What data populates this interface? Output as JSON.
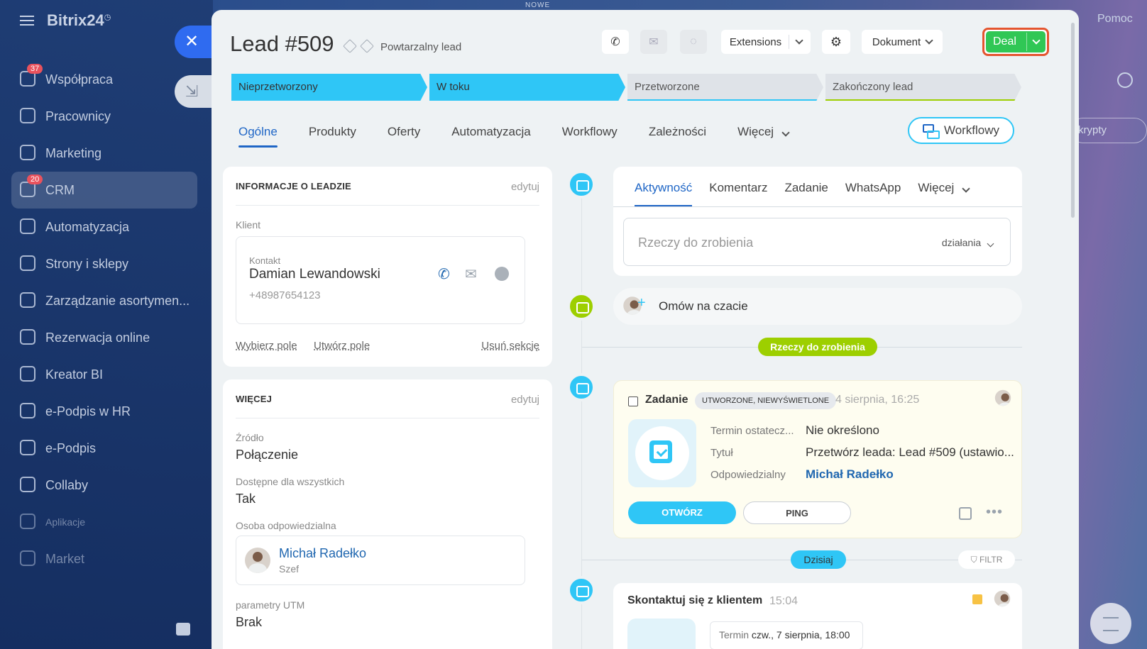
{
  "app": {
    "brand": "Bitrix24",
    "top_label": "NOWE",
    "help": "Pomoc",
    "right_pill": "krypty"
  },
  "nav": {
    "items": [
      {
        "label": "Współpraca",
        "counter": "37"
      },
      {
        "label": "Pracownicy"
      },
      {
        "label": "Marketing"
      },
      {
        "label": "CRM",
        "counter": "20"
      },
      {
        "label": "Automatyzacja"
      },
      {
        "label": "Strony i sklepy"
      },
      {
        "label": "Zarządzanie asortymen..."
      },
      {
        "label": "Rezerwacja online"
      },
      {
        "label": "Kreator BI"
      },
      {
        "label": "e-Podpis w HR"
      },
      {
        "label": "e-Podpis"
      },
      {
        "label": "Collaby"
      },
      {
        "label": "Aplikacje"
      },
      {
        "label": "Market"
      }
    ]
  },
  "header": {
    "title": "Lead #509",
    "subtitle": "Powtarzalny lead",
    "extensions": "Extensions",
    "dokument": "Dokument",
    "deal": "Deal"
  },
  "stages": [
    "Nieprzetworzony",
    "W toku",
    "Przetworzone",
    "Zakończony lead"
  ],
  "tabs": [
    "Ogólne",
    "Produkty",
    "Oferty",
    "Automatyzacja",
    "Workflowy",
    "Zależności",
    "Więcej"
  ],
  "workflow_button": "Workflowy",
  "info_card": {
    "title": "INFORMACJE O LEADZIE",
    "edit": "edytuj",
    "client_label": "Klient",
    "contact_label": "Kontakt",
    "contact_name": "Damian Lewandowski",
    "phone": "+48987654123",
    "select_field": "Wybierz pole",
    "create_field": "Utwórz pole",
    "delete_section": "Usuń sekcję"
  },
  "more_card": {
    "title": "WIĘCEJ",
    "edit": "edytuj",
    "source_label": "Źródło",
    "source_value": "Połączenie",
    "available_label": "Dostępne dla wszystkich",
    "available_value": "Tak",
    "responsible_label": "Osoba odpowiedzialna",
    "responsible_name": "Michał Radełko",
    "responsible_role": "Szef",
    "utm_label": "parametry UTM",
    "utm_value": "Brak"
  },
  "activity": {
    "tabs": [
      "Aktywność",
      "Komentarz",
      "Zadanie",
      "WhatsApp",
      "Więcej"
    ],
    "placeholder": "Rzeczy do zrobienia",
    "actions": "działania",
    "chat": "Omów na czacie",
    "todo_badge": "Rzeczy do zrobienia",
    "today_badge": "Dzisiaj",
    "filter": "FILTR"
  },
  "task": {
    "title": "Zadanie",
    "tag": "UTWORZONE, NIEWYŚWIETLONE",
    "date": "4 sierpnia, 16:25",
    "deadline_label": "Termin ostatecz...",
    "deadline_value": "Nie określono",
    "title_label": "Tytuł",
    "title_value": "Przetwórz leada: Lead #509 (ustawio...",
    "responsible_label": "Odpowiedzialny",
    "responsible_value": "Michał Radełko",
    "open_button": "OTWÓRZ",
    "ping_button": "PING"
  },
  "contact_task": {
    "title": "Skontaktuj się z klientem",
    "time": "15:04",
    "deadline_label": "Termin",
    "deadline_value": "czw., 7 sierpnia, 18:00"
  },
  "colors": {
    "accent": "#2fc6f6",
    "deal_green": "#30c755",
    "deal_border": "#e4552f",
    "link_blue": "#2067b0",
    "todo_green": "#9dcf00"
  }
}
